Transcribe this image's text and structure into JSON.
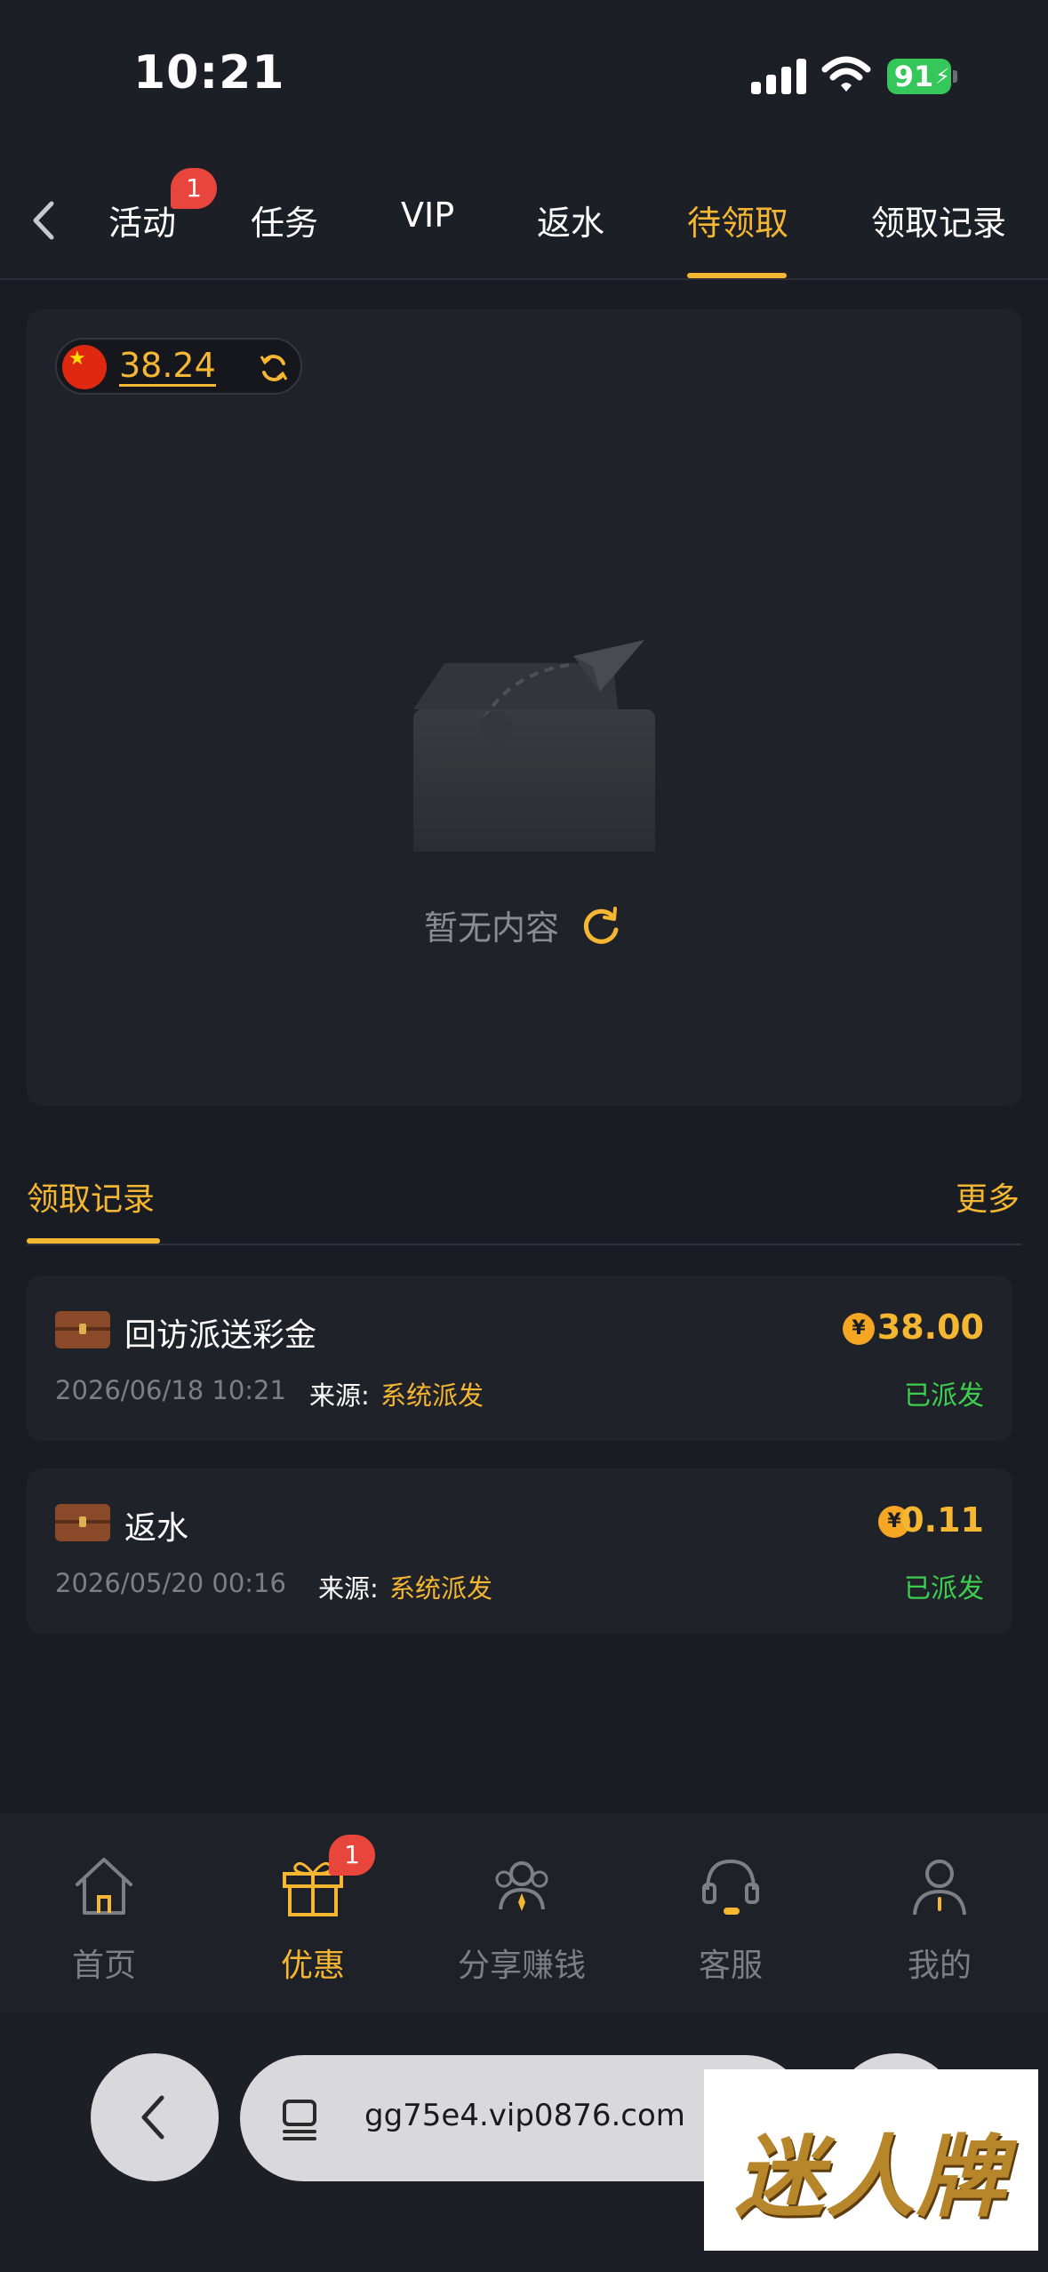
{
  "status_bar": {
    "time": "10:21",
    "battery": "91"
  },
  "top_nav": {
    "tabs": [
      {
        "label": "活动",
        "badge": "1"
      },
      {
        "label": "任务"
      },
      {
        "label": "VIP"
      },
      {
        "label": "返水"
      },
      {
        "label": "待领取",
        "active": true
      },
      {
        "label": "领取记录"
      }
    ]
  },
  "balance": {
    "value": "38.24"
  },
  "empty_state": {
    "text": "暂无内容"
  },
  "records_section": {
    "title": "领取记录",
    "more": "更多",
    "items": [
      {
        "title": "回访派送彩金",
        "amount": "38.00",
        "date": "2026/06/18 10:21",
        "source_label": "来源:",
        "source_value": "系统派发",
        "status": "已派发"
      },
      {
        "title": "返水",
        "amount": "0.11",
        "date": "2026/05/20 00:16",
        "source_label": "来源:",
        "source_value": "系统派发",
        "status": "已派发"
      }
    ]
  },
  "bottom_nav": {
    "items": [
      {
        "label": "首页",
        "icon": "home-icon"
      },
      {
        "label": "优惠",
        "icon": "gift-icon",
        "badge": "1",
        "active": true
      },
      {
        "label": "分享赚钱",
        "icon": "share-users-icon"
      },
      {
        "label": "客服",
        "icon": "headset-icon"
      },
      {
        "label": "我的",
        "icon": "profile-icon"
      }
    ]
  },
  "browser": {
    "url": "gg75e4.vip0876.com"
  },
  "watermark": {
    "text": "迷人牌"
  },
  "colors": {
    "accent": "#f5b731",
    "badge": "#e8453c",
    "success": "#3ccf4e",
    "background": "#1a1c23"
  },
  "coin_symbol": "¥"
}
